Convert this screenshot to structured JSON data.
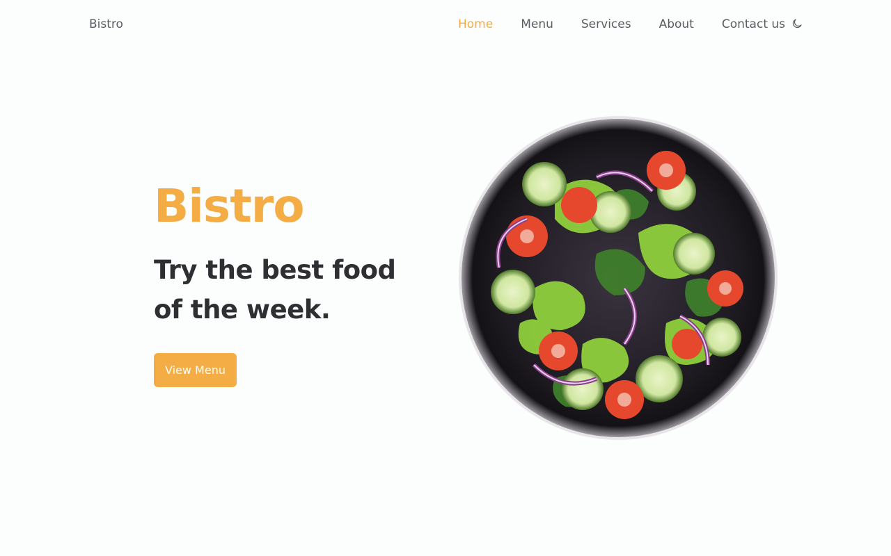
{
  "header": {
    "brand": "Bistro",
    "nav": [
      {
        "label": "Home",
        "active": true
      },
      {
        "label": "Menu",
        "active": false
      },
      {
        "label": "Services",
        "active": false
      },
      {
        "label": "About",
        "active": false
      },
      {
        "label": "Contact us",
        "active": false
      }
    ],
    "theme_toggle_icon": "moon-icon"
  },
  "hero": {
    "title": "Bistro",
    "subtitle": "Try the best food of the week.",
    "cta_label": "View Menu",
    "image_icon": "salad-plate-image"
  },
  "colors": {
    "accent": "#f4ac45",
    "text": "#2f2f33",
    "nav_text": "#5b5d63",
    "background": "#fcfdfd"
  }
}
